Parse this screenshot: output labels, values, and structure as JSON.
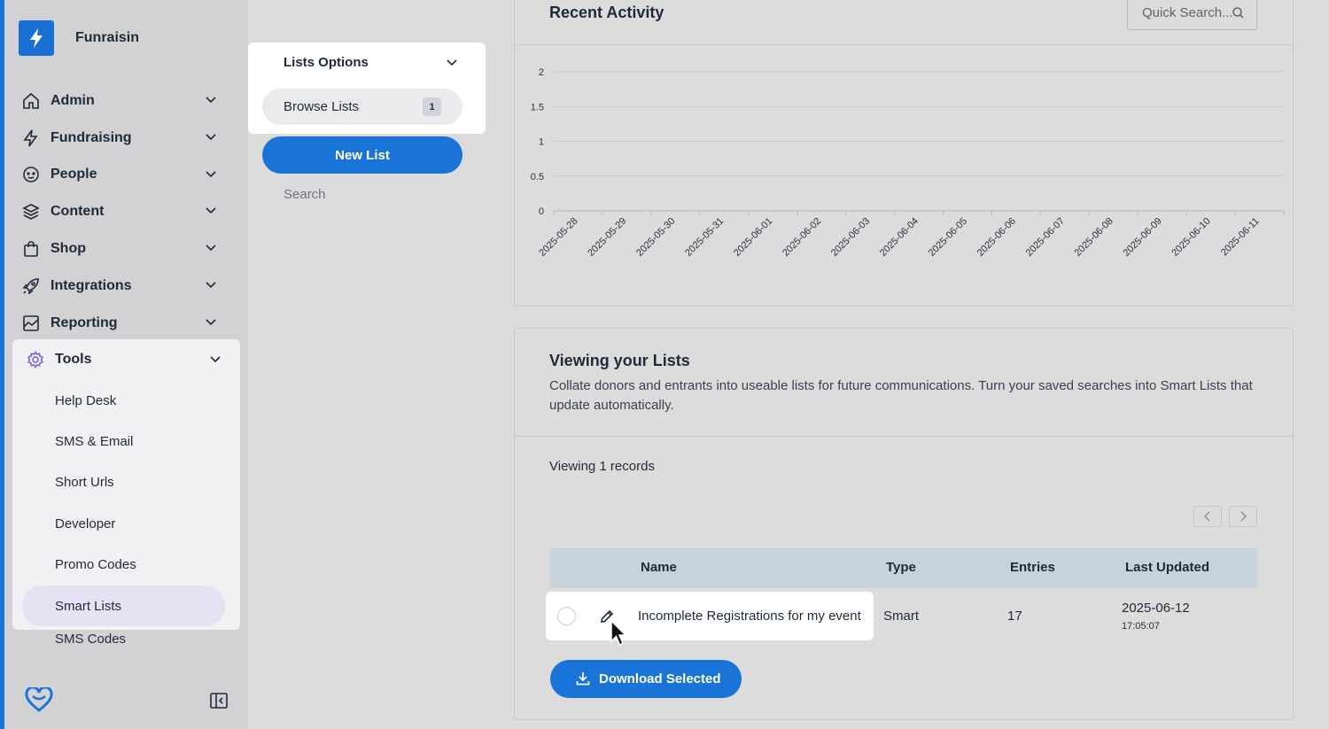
{
  "brand": {
    "name": "Funraisin"
  },
  "colors": {
    "accent": "#1a73d6",
    "sidebar_bg": "#d2d2d4",
    "active_pill": "#e6e2f3",
    "table_head": "#c7d2dc"
  },
  "sidebar": {
    "items": [
      {
        "label": "Admin",
        "icon": "home-icon"
      },
      {
        "label": "Fundraising",
        "icon": "lightning-icon"
      },
      {
        "label": "People",
        "icon": "face-icon"
      },
      {
        "label": "Content",
        "icon": "layers-icon"
      },
      {
        "label": "Shop",
        "icon": "shopping-bag-icon"
      },
      {
        "label": "Integrations",
        "icon": "rocket-icon"
      },
      {
        "label": "Reporting",
        "icon": "chart-icon"
      }
    ],
    "tools": {
      "label": "Tools",
      "icon": "gear-icon",
      "subitems": [
        "Help Desk",
        "SMS & Email",
        "Short Urls",
        "Developer",
        "Promo Codes",
        "Smart Lists"
      ],
      "active": "Smart Lists"
    },
    "extra_item": "SMS Codes"
  },
  "lists_options": {
    "title": "Lists Options",
    "browse_label": "Browse Lists",
    "browse_count": "1",
    "new_list_label": "New List",
    "search_label": "Search"
  },
  "activity": {
    "title": "Recent Activity",
    "search_placeholder": "Quick Search..."
  },
  "chart_data": {
    "type": "line",
    "title": "",
    "x": [
      "2025-05-28",
      "2025-05-29",
      "2025-05-30",
      "2025-05-31",
      "2025-06-01",
      "2025-06-02",
      "2025-06-03",
      "2025-06-04",
      "2025-06-05",
      "2025-06-06",
      "2025-06-07",
      "2025-06-08",
      "2025-06-09",
      "2025-06-10",
      "2025-06-11"
    ],
    "series": [],
    "y_ticks": [
      "0",
      "0.5",
      "1",
      "1.5",
      "2"
    ],
    "ylim": [
      0,
      2
    ],
    "grid": true
  },
  "lists": {
    "title": "Viewing your Lists",
    "description": "Collate donors and entrants into useable lists for future communications. Turn your saved searches into Smart Lists that update automatically.",
    "records_label": "Viewing 1 records",
    "columns": {
      "name": "Name",
      "type": "Type",
      "entries": "Entries",
      "updated": "Last Updated"
    },
    "rows": [
      {
        "name": "Incomplete Registrations for my event",
        "type": "Smart",
        "entries": "17",
        "date": "2025-06-12",
        "time": "17:05:07"
      }
    ],
    "download_label": "Download Selected"
  }
}
